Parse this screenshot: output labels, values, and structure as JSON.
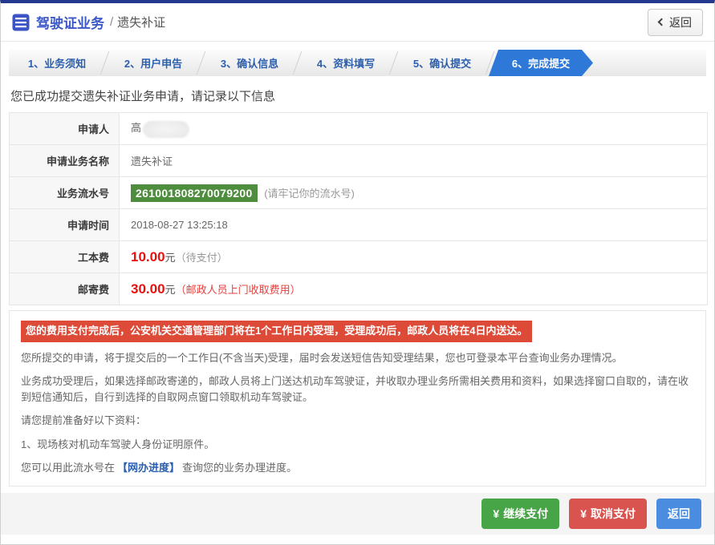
{
  "colors": {
    "top_bar_navy": "#24388e",
    "active_step_blue": "#2e79d8",
    "serial_badge_green": "#4e8c3e",
    "price_red": "#e8110f",
    "banner_red": "#dd4a38",
    "continue_btn_green": "#47a447",
    "cancel_btn_red": "#d9534f",
    "return_btn_blue": "#4a8de0"
  },
  "header": {
    "title": "驾驶证业务",
    "separator": "/",
    "subtitle": "遗失补证",
    "back_label": "返回"
  },
  "steps": [
    {
      "label": "1、业务须知"
    },
    {
      "label": "2、用户申告"
    },
    {
      "label": "3、确认信息"
    },
    {
      "label": "4、资料填写"
    },
    {
      "label": "5、确认提交"
    },
    {
      "label": "6、完成提交",
      "active": true
    }
  ],
  "result": {
    "success_message": "您已成功提交遗失补证业务申请，请记录以下信息",
    "table": {
      "applicant": {
        "label": "申请人",
        "value": "高"
      },
      "business_name": {
        "label": "申请业务名称",
        "value": "遗失补证"
      },
      "serial": {
        "label": "业务流水号",
        "value": "261001808270079200",
        "hint": "(请牢记你的流水号)"
      },
      "apply_time": {
        "label": "申请时间",
        "value": "2018-08-27 13:25:18"
      },
      "production_fee": {
        "label": "工本费",
        "amount": "10.00",
        "unit": "元",
        "note": "（待支付）"
      },
      "postage_fee": {
        "label": "邮寄费",
        "amount": "30.00",
        "unit": "元",
        "note": "（邮政人员上门收取费用）"
      }
    }
  },
  "notices": {
    "banner": "您的费用支付完成后，公安机关交通管理部门将在1个工作日内受理，受理成功后，邮政人员将在4日内送达。",
    "p1": "您所提交的申请，将于提交后的一个工作日(不含当天)受理，届时会发送短信告知受理结果，您也可登录本平台查询业务办理情况。",
    "p2": "业务成功受理后，如果选择邮政寄递的，邮政人员将上门送达机动车驾驶证，并收取办理业务所需相关费用和资料，如果选择窗口自取的，请在收到短信通知后，自行到选择的自取网点窗口领取机动车驾驶证。",
    "p3": "请您提前准备好以下资料：",
    "p4": "1、现场核对机动车驾驶人身份证明原件。",
    "progress_prefix": "您可以用此流水号在",
    "progress_link": "【网办进度】",
    "progress_suffix": "查询您的业务办理进度。"
  },
  "footer": {
    "currency_symbol": "¥",
    "continue_label": "继续支付",
    "cancel_label": "取消支付",
    "return_label": "返回"
  }
}
